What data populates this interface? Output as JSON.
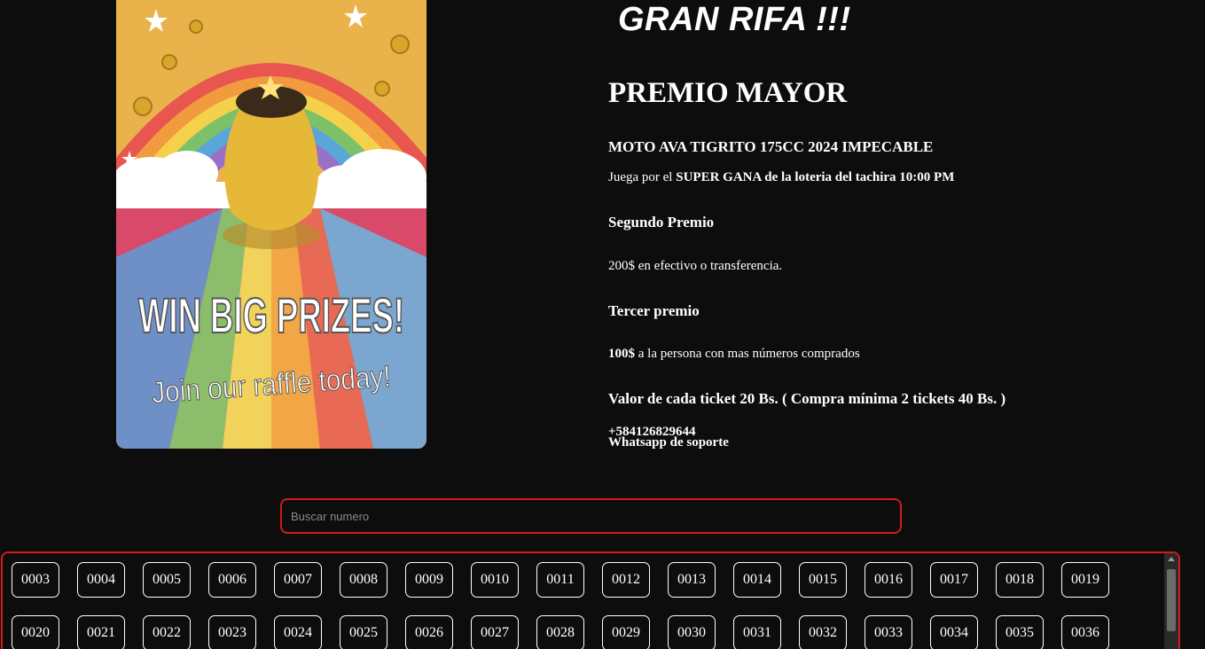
{
  "poster": {
    "headline": "WIN BIG PRIZES!",
    "tagline": "Join our raffle today!"
  },
  "brand": {
    "title": "GRAN RIFA !!!"
  },
  "info": {
    "main_prize_heading": "PREMIO MAYOR",
    "main_prize_item": "MOTO AVA TIGRITO 175CC 2024 IMPECABLE",
    "draw_prefix": "Juega por el ",
    "draw_bold": "SUPER GANA de la loteria del tachira 10:00 PM",
    "second_heading": "Segundo Premio",
    "second_desc": "200$ en efectivo o transferencia.",
    "third_heading": "Tercer premio",
    "third_bold": "100$",
    "third_rest": " a la persona con mas números comprados",
    "ticket_price": "Valor de cada ticket 20 Bs. ( Compra mínima 2 tickets 40 Bs. )",
    "phone": "+584126829644",
    "support_label": "Whatsapp de soporte"
  },
  "search": {
    "placeholder": "Buscar numero",
    "value": ""
  },
  "tickets": [
    "0003",
    "0004",
    "0005",
    "0006",
    "0007",
    "0008",
    "0009",
    "0010",
    "0011",
    "0012",
    "0013",
    "0014",
    "0015",
    "0016",
    "0017",
    "0018",
    "0019",
    "0020",
    "0021",
    "0022",
    "0023",
    "0024",
    "0025",
    "0026",
    "0027",
    "0028",
    "0029",
    "0030",
    "0031",
    "0032",
    "0033",
    "0034",
    "0035",
    "0036"
  ],
  "colors": {
    "background": "#0d0d0d",
    "accent_border": "#d41a1a",
    "text": "#ffffff"
  }
}
